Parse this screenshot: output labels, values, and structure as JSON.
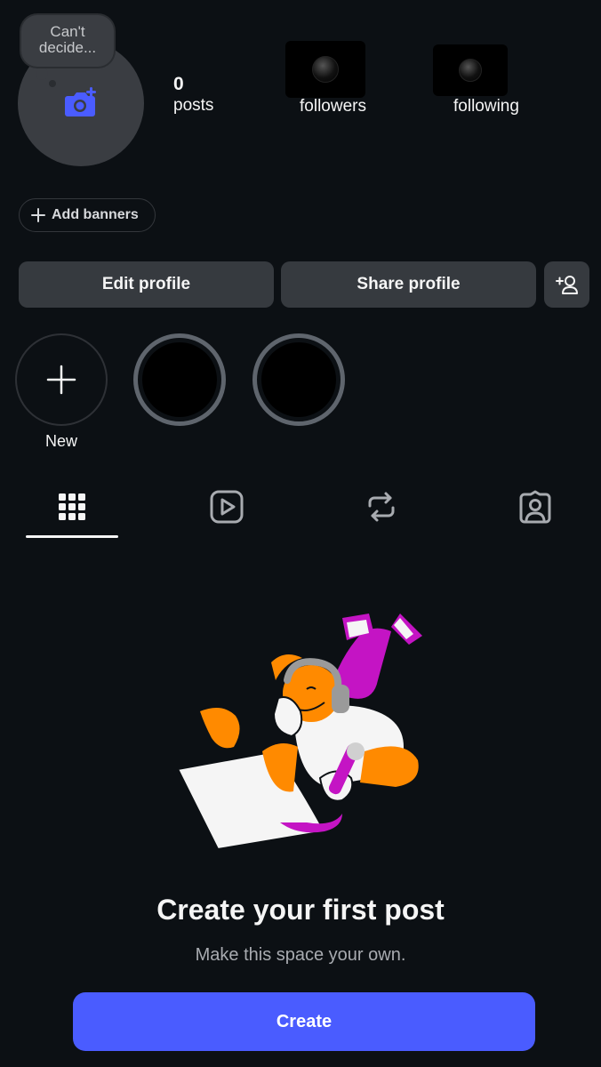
{
  "profile": {
    "note_text": "Can't decide...",
    "avatar_icon": "camera-add-icon",
    "stats": {
      "posts_count": "0",
      "posts_label": "posts",
      "followers_label": "followers",
      "following_label": "following"
    }
  },
  "add_banners": {
    "icon": "plus-icon",
    "label": "Add banners"
  },
  "actions": {
    "edit_label": "Edit profile",
    "share_label": "Share profile",
    "add_person_icon": "add-person-icon"
  },
  "highlights": {
    "new_label": "New"
  },
  "tabs": [
    {
      "name": "grid",
      "icon": "grid-icon",
      "active": true
    },
    {
      "name": "reels",
      "icon": "reels-icon",
      "active": false
    },
    {
      "name": "reposts",
      "icon": "repost-icon",
      "active": false
    },
    {
      "name": "tagged",
      "icon": "tagged-icon",
      "active": false
    }
  ],
  "empty_state": {
    "title": "Create your first post",
    "subtitle": "Make this space your own.",
    "button_label": "Create"
  },
  "colors": {
    "background": "#0c1014",
    "surface": "#363a3f",
    "accent": "#4a5cff",
    "muted_text": "#a8abb0"
  }
}
